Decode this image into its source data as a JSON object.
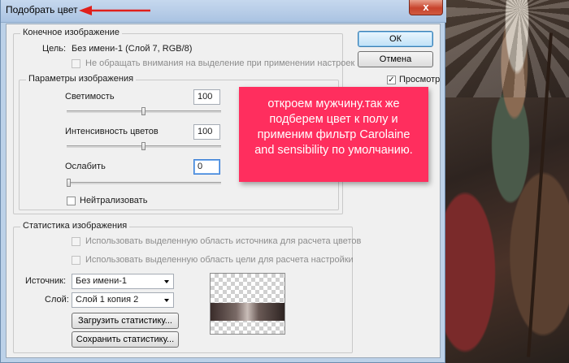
{
  "window": {
    "title": "Подобрать цвет",
    "close_label": "x"
  },
  "final_image": {
    "legend": "Конечное изображение",
    "target_label": "Цель:",
    "target_value": "Без имени-1 (Слой 7, RGB/8)",
    "ignore_selection_label": "Не обращать внимания на выделение при применении настроек",
    "ignore_selection_checked": false
  },
  "image_options": {
    "legend": "Параметры изображения",
    "luminance_label": "Светимость",
    "luminance_value": "100",
    "luminance_slider": 0.5,
    "color_intensity_label": "Интенсивность цветов",
    "color_intensity_value": "100",
    "color_intensity_slider": 0.5,
    "fade_label": "Ослабить",
    "fade_value": "0",
    "fade_slider": 0.0,
    "neutralize_label": "Нейтрализовать",
    "neutralize_checked": false
  },
  "buttons": {
    "ok": "ОК",
    "cancel": "Отмена",
    "preview_label": "Просмотр",
    "preview_checked": true
  },
  "image_statistics": {
    "legend": "Статистика изображения",
    "use_source_selection_label": "Использовать выделенную область источника для расчета цветов",
    "use_target_selection_label": "Использовать выделенную область цели для расчета настройки",
    "source_label": "Источник:",
    "source_value": "Без имени-1",
    "layer_label": "Слой:",
    "layer_value": "Слой 1 копия 2",
    "load_stats_label": "Загрузить статистику...",
    "save_stats_label": "Сохранить статистику..."
  },
  "overlay_note": {
    "text": "откроем мужчину.так же подберем цвет к полу и применим фильтр Carolaine and sensibility по умолчанию."
  },
  "colors": {
    "accent_arrow": "#e0201c",
    "note_background": "#ff2e5e",
    "titlebar": "#bcd1e8"
  }
}
